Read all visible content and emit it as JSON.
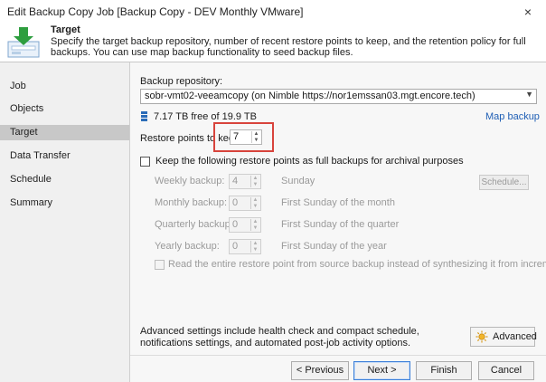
{
  "window": {
    "title": "Edit Backup Copy Job [Backup Copy - DEV Monthly VMware]",
    "close_glyph": "×"
  },
  "header": {
    "title": "Target",
    "description": "Specify the target backup repository, number of recent restore points to keep, and the retention policy for full backups. You can use map backup functionality to seed backup files.",
    "icon": "target-download-icon"
  },
  "nav": {
    "items": [
      "Job",
      "Objects",
      "Target",
      "Data Transfer",
      "Schedule",
      "Summary"
    ],
    "active": "Target"
  },
  "target": {
    "repo_label": "Backup repository:",
    "repo_value": "sobr-vmt02-veeamcopy (on Nimble https://nor1emssan03.mgt.encore.tech)",
    "free_space": "7.17 TB free of 19.9 TB",
    "map_backup_link": "Map backup",
    "restore_points_label": "Restore points to keep:",
    "restore_points_value": "7",
    "archival_label": "Keep the following restore points as full backups for archival purposes",
    "weekly": {
      "label": "Weekly backup:",
      "value": "4",
      "desc": "Sunday"
    },
    "schedule_button": "Schedule...",
    "monthly": {
      "label": "Monthly backup:",
      "value": "0",
      "desc": "First Sunday of the month"
    },
    "quarterly": {
      "label": "Quarterly backup:",
      "value": "0",
      "desc": "First Sunday of the quarter"
    },
    "yearly": {
      "label": "Yearly backup:",
      "value": "0",
      "desc": "First Sunday of the year"
    },
    "read_entire_label": "Read the entire restore point from source backup instead of synthesizing it from increments",
    "advanced_text": "Advanced settings include health check and compact schedule, notifications settings, and automated post-job activity options.",
    "advanced_button": "Advanced"
  },
  "footer": {
    "previous": "< Previous",
    "next": "Next >",
    "finish": "Finish",
    "cancel": "Cancel"
  },
  "colors": {
    "highlight": "#d8443c",
    "nav_active": "#c8c8c8",
    "link": "#1f5fb5",
    "icon_green": "#2e9e3f"
  }
}
